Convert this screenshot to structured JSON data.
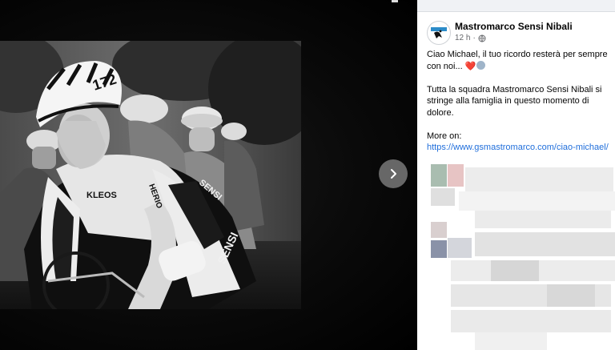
{
  "post": {
    "page_name": "Mastromarco Sensi Nibali",
    "time": "12 h",
    "separator": "·",
    "message_line": "Ciao Michael, il tuo ricordo resterà per sempre con noi...",
    "message_emojis": "❤️",
    "paragraph2": "Tutta la squadra Mastromarco Sensi Nibali si stringe alla famiglia in questo momento di dolore.",
    "more_label": "More on:",
    "link": "https://www.gsmastromarco.com/ciao-michael/"
  },
  "photo": {
    "jersey_number": "172",
    "sponsor_1": "KLEOS",
    "sponsor_2": "HERIO",
    "sponsor_3": "SENSI",
    "sponsor_4": "SENSI"
  },
  "icons": {
    "next": "chevron-right-icon",
    "privacy": "globe-icon",
    "avatar": "team-logo-icon"
  },
  "colors": {
    "link": "#216fdb",
    "heart": "#e02c3d",
    "next_button": "#787878",
    "meta_text": "#65676b"
  }
}
